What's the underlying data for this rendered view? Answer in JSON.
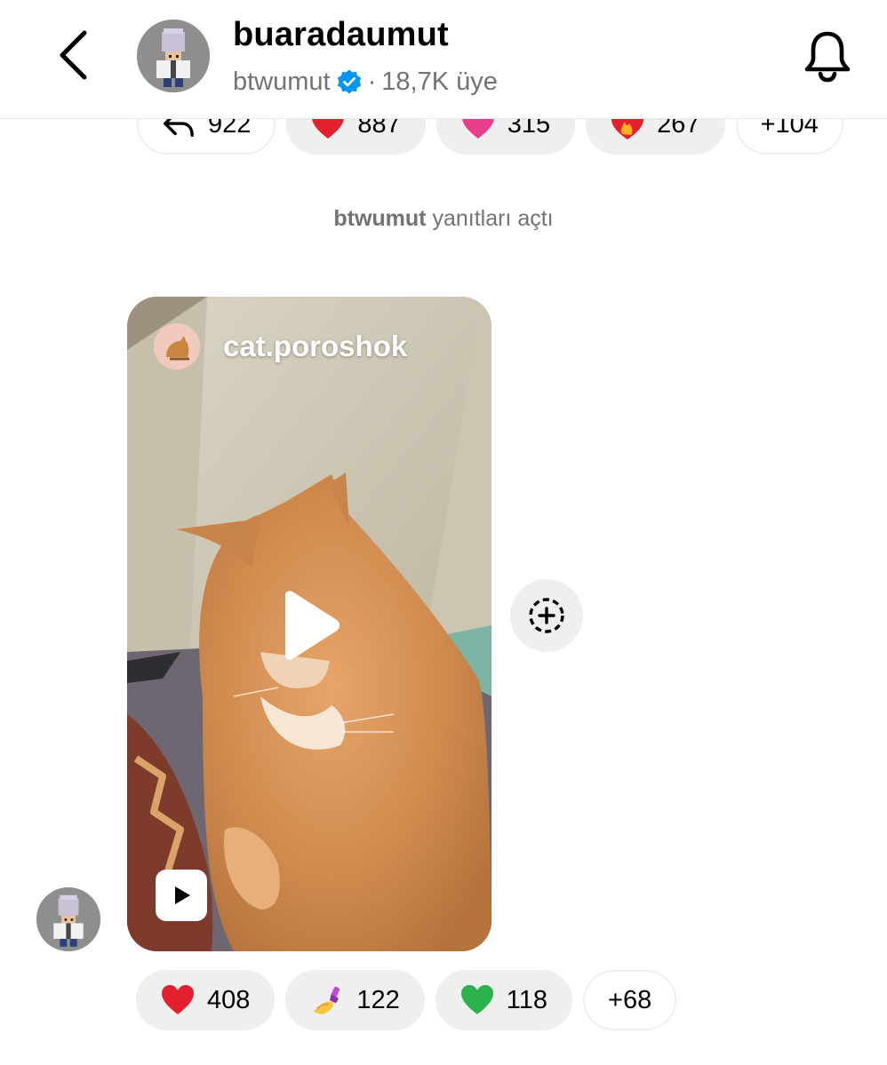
{
  "header": {
    "channel_name": "buaradaumut",
    "owner_username": "btwumut",
    "separator": "·",
    "member_count": "18,7K üye",
    "back_icon": "chevron-left-icon",
    "bell_icon": "bell-icon",
    "verified_color": "#0095F6"
  },
  "top_reactions": [
    {
      "icon": "reply-arrow-icon",
      "count": "922"
    },
    {
      "icon": "red-heart-emoji",
      "count": "887"
    },
    {
      "icon": "pink-heart-emoji",
      "count": "315"
    },
    {
      "icon": "heart-on-fire-emoji",
      "count": "267"
    },
    {
      "icon": null,
      "count": "+104"
    }
  ],
  "system_message": {
    "username": "btwumut",
    "text": " yanıtları açtı"
  },
  "reel": {
    "author": "cat.poroshok",
    "play_icon": "play-icon",
    "badge_icon": "reels-icon"
  },
  "share_icon": "add-story-icon",
  "bottom_reactions": [
    {
      "icon": "red-heart-emoji",
      "count": "408"
    },
    {
      "icon": "nail-polish-emoji",
      "count": "122"
    },
    {
      "icon": "green-heart-emoji",
      "count": "118"
    },
    {
      "icon": null,
      "count": "+68"
    }
  ],
  "colors": {
    "chip_bg": "#EFEFEF",
    "secondary_text": "#737373",
    "red_heart": "#E5202E",
    "green_heart": "#2BB24C",
    "pink_heart": "#E83E8C"
  }
}
